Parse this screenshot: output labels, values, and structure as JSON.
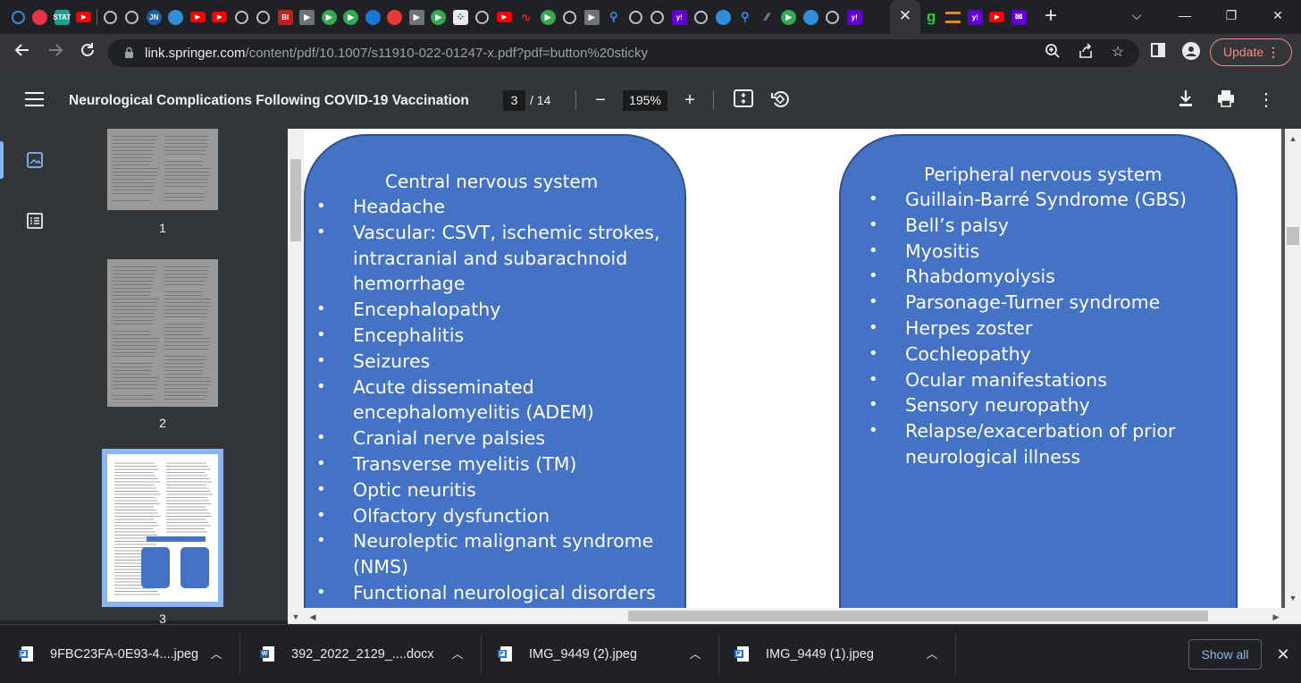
{
  "browser": {
    "tabs": [
      {
        "icon": "globe-icon",
        "color": "#3a8dde",
        "text": ""
      },
      {
        "icon": "sport-icon",
        "color": "#e8334a",
        "text": ""
      },
      {
        "icon": "stat-icon",
        "color": "#1e9e8f",
        "text": "STAT"
      },
      {
        "icon": "youtube-icon",
        "color": "#ff0000",
        "text": ""
      },
      {
        "icon": "globe-icon",
        "color": "#bdc1c6",
        "text": ""
      },
      {
        "icon": "globe-icon",
        "color": "#bdc1c6",
        "text": ""
      },
      {
        "icon": "jn-icon",
        "color": "#1a5fa8",
        "text": "JN"
      },
      {
        "icon": "medical-icon",
        "color": "#2f8fd8",
        "text": ""
      },
      {
        "icon": "youtube-icon",
        "color": "#ff0000",
        "text": ""
      },
      {
        "icon": "youtube-icon",
        "color": "#ff0000",
        "text": ""
      },
      {
        "icon": "globe-icon",
        "color": "#bdc1c6",
        "text": ""
      },
      {
        "icon": "globe-icon",
        "color": "#bdc1c6",
        "text": ""
      },
      {
        "icon": "bi-icon",
        "color": "#c41f1f",
        "text": "BI"
      },
      {
        "icon": "arrow-icon",
        "color": "#6f7378",
        "text": ""
      },
      {
        "icon": "play-icon",
        "color": "#34a853",
        "text": ""
      },
      {
        "icon": "play-icon",
        "color": "#34a853",
        "text": ""
      },
      {
        "icon": "moon-icon",
        "color": "#1976d2",
        "text": ""
      },
      {
        "icon": "download-red-icon",
        "color": "#e53935",
        "text": ""
      },
      {
        "icon": "arrow-icon",
        "color": "#6f7378",
        "text": ""
      },
      {
        "icon": "play-icon",
        "color": "#34a853",
        "text": ""
      },
      {
        "icon": "grid-icon",
        "color": "#e8eaed",
        "text": ""
      },
      {
        "icon": "globe-icon",
        "color": "#bdc1c6",
        "text": ""
      },
      {
        "icon": "youtube-icon",
        "color": "#ff0000",
        "text": ""
      },
      {
        "icon": "wave-icon",
        "color": "#c62828",
        "text": ""
      },
      {
        "icon": "play-icon",
        "color": "#34a853",
        "text": ""
      },
      {
        "icon": "globe-icon",
        "color": "#bdc1c6",
        "text": ""
      },
      {
        "icon": "arrow-icon",
        "color": "#6f7378",
        "text": ""
      },
      {
        "icon": "search-icon",
        "color": "#4285f4",
        "text": ""
      },
      {
        "icon": "globe-icon",
        "color": "#bdc1c6",
        "text": ""
      },
      {
        "icon": "globe-icon",
        "color": "#bdc1c6",
        "text": ""
      },
      {
        "icon": "yahoo-icon",
        "color": "#6001d2",
        "text": "y!"
      },
      {
        "icon": "globe-icon",
        "color": "#bdc1c6",
        "text": ""
      },
      {
        "icon": "medical-icon",
        "color": "#2f8fd8",
        "text": ""
      },
      {
        "icon": "search-icon",
        "color": "#4285f4",
        "text": ""
      },
      {
        "icon": "slash-icon",
        "color": "#9aa0a6",
        "text": ""
      },
      {
        "icon": "play-icon",
        "color": "#34a853",
        "text": ""
      },
      {
        "icon": "medical-icon",
        "color": "#2f8fd8",
        "text": ""
      },
      {
        "icon": "globe-icon",
        "color": "#bdc1c6",
        "text": ""
      },
      {
        "icon": "yahoo-icon",
        "color": "#6001d2",
        "text": "y!"
      }
    ],
    "after_tabs": [
      {
        "icon": "g-icon",
        "color": "#2ecc40",
        "text": "g"
      },
      {
        "icon": "stack-icon",
        "color": "#f48024",
        "text": ""
      },
      {
        "icon": "yahoo-icon",
        "color": "#6001d2",
        "text": "y!"
      },
      {
        "icon": "youtube-icon",
        "color": "#ff0000",
        "text": ""
      },
      {
        "icon": "mail-icon",
        "color": "#6001d2",
        "text": ""
      }
    ],
    "url_host": "link.springer.com",
    "url_path": "/content/pdf/10.1007/s11910-022-01247-x.pdf?pdf=button%20sticky",
    "update_label": "Update"
  },
  "pdf": {
    "title": "Neurological Complications Following COVID-19 Vaccination",
    "current_page": "3",
    "total_pages": "/ 14",
    "zoom": "195%",
    "thumb_labels": [
      "1",
      "2",
      "3"
    ]
  },
  "figure": {
    "left_title": "Central nervous system",
    "left_items": [
      "Headache",
      "Vascular: CSVT, ischemic strokes,",
      "intracranial and subarachnoid",
      "hemorrhage",
      "Encephalopathy",
      "Encephalitis",
      "Seizures",
      "Acute disseminated",
      "encephalomyelitis (ADEM)",
      "Cranial nerve palsies",
      "Transverse myelitis (TM)",
      "Optic neuritis",
      "Olfactory dysfunction",
      "Neuroleptic malignant syndrome",
      "(NMS)",
      "Functional neurological disorders"
    ],
    "left_bullets": [
      true,
      true,
      false,
      false,
      true,
      true,
      true,
      true,
      false,
      true,
      true,
      true,
      true,
      true,
      false,
      true
    ],
    "right_title": "Peripheral nervous system",
    "right_items": [
      "Guillain-Barré Syndrome (GBS)",
      "Bell’s palsy",
      "Myositis",
      "Rhabdomyolysis",
      "Parsonage-Turner syndrome",
      "Herpes zoster",
      "Cochleopathy",
      "Ocular manifestations",
      "Sensory neuropathy",
      "Relapse/exacerbation of prior",
      "neurological illness"
    ],
    "right_bullets": [
      true,
      true,
      true,
      true,
      true,
      true,
      true,
      true,
      true,
      true,
      false
    ],
    "bullet_char": "•"
  },
  "downloads": {
    "items": [
      {
        "name": "9FBC23FA-0E93-4....jpeg",
        "type": "image"
      },
      {
        "name": "392_2022_2129_....docx",
        "type": "word"
      },
      {
        "name": "IMG_9449 (2).jpeg",
        "type": "image"
      },
      {
        "name": "IMG_9449 (1).jpeg",
        "type": "image"
      }
    ],
    "show_all": "Show all"
  }
}
